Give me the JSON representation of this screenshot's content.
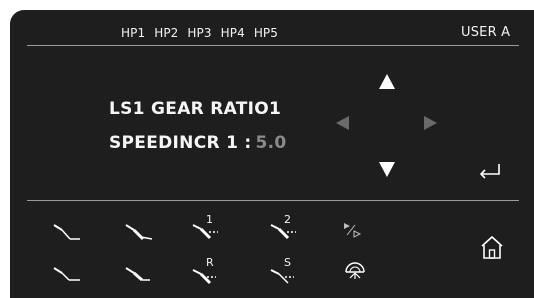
{
  "header": {
    "hp_tabs": [
      "HP1",
      "HP2",
      "HP3",
      "HP4",
      "HP5"
    ],
    "user": "USER A"
  },
  "main": {
    "title": "LS1 GEAR RATIO1",
    "speed_label": "SPEEDINCR 1 :",
    "speed_value": "5.0"
  },
  "nav": {
    "up": "arrow-up-icon",
    "down": "arrow-down-icon",
    "left": "arrow-left-icon",
    "right": "arrow-right-icon",
    "enter": "enter-icon",
    "home": "home-icon"
  },
  "instruments": [
    {
      "name": "handpiece-1",
      "label": ""
    },
    {
      "name": "handpiece-2",
      "label": ""
    },
    {
      "name": "handpiece-3",
      "label": "1"
    },
    {
      "name": "handpiece-4",
      "label": "2"
    },
    {
      "name": "play-pause",
      "label": ""
    },
    {
      "name": "handpiece-5",
      "label": ""
    },
    {
      "name": "handpiece-6",
      "label": ""
    },
    {
      "name": "handpiece-7",
      "label": "R"
    },
    {
      "name": "handpiece-8",
      "label": "S"
    },
    {
      "name": "light",
      "label": ""
    }
  ],
  "colors": {
    "panel": "#1e1e1e",
    "text": "#f2f2f2",
    "disabled": "#6a6a6a",
    "value": "#8a8a8a"
  }
}
